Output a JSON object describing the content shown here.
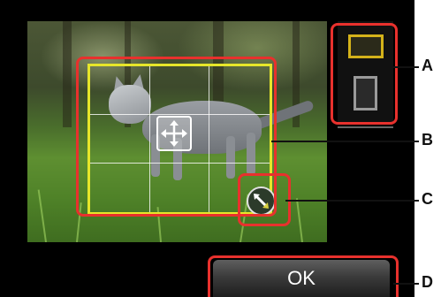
{
  "ok_button": {
    "label": "OK"
  },
  "orientation": {
    "selected": "landscape",
    "options": [
      "landscape",
      "portrait"
    ]
  },
  "colors": {
    "crop_frame": "#e6e62a",
    "callout_highlight": "#e8312d",
    "landscape_selected": "#d4b21a",
    "portrait_unselected": "#9a9a9a",
    "screen_background": "#000000"
  },
  "icons": {
    "move": "move-arrows-icon",
    "resize": "resize-handle-icon",
    "landscape": "landscape-frame-icon",
    "portrait": "portrait-frame-icon"
  },
  "callouts": [
    {
      "label": "A"
    },
    {
      "label": "B"
    },
    {
      "label": "C"
    },
    {
      "label": "D"
    }
  ]
}
